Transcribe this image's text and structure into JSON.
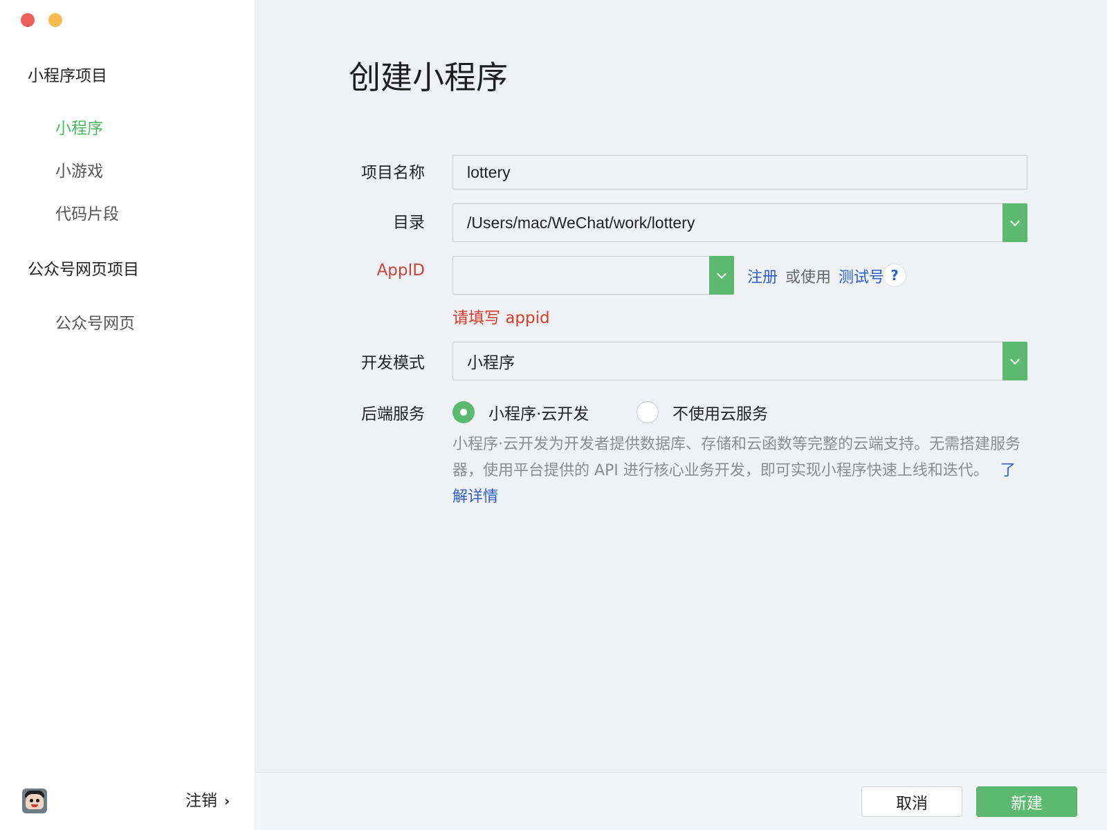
{
  "window": {
    "traffic_lights": [
      "close",
      "minimize"
    ]
  },
  "sidebar": {
    "group_mini": "小程序项目",
    "items_mini": [
      {
        "label": "小程序",
        "active": true
      },
      {
        "label": "小游戏",
        "active": false
      },
      {
        "label": "代码片段",
        "active": false
      }
    ],
    "group_official": "公众号网页项目",
    "items_official": [
      {
        "label": "公众号网页",
        "active": false
      }
    ],
    "logout_label": "注销",
    "avatar_icon": "user-avatar"
  },
  "main": {
    "title": "创建小程序",
    "project_name": {
      "label": "项目名称",
      "value": "lottery"
    },
    "directory": {
      "label": "目录",
      "value": "/Users/mac/WeChat/work/lottery"
    },
    "appid": {
      "label": "AppID",
      "value": "",
      "register_link": "注册",
      "or_use": "或使用",
      "test_link": "测试号",
      "help": "?",
      "error_prefix": "请填写",
      "error_word": "appid"
    },
    "dev_mode": {
      "label": "开发模式",
      "value": "小程序"
    },
    "backend": {
      "label": "后端服务",
      "options": [
        {
          "label": "小程序·云开发",
          "checked": true
        },
        {
          "label": "不使用云服务",
          "checked": false
        }
      ],
      "description": "小程序·云开发为开发者提供数据库、存储和云函数等完整的云端支持。无需搭建服务器，使用平台提供的 API 进行核心业务开发，即可实现小程序快速上线和迭代。",
      "learn_more": "了解详情"
    }
  },
  "footer": {
    "cancel_label": "取消",
    "create_label": "新建"
  },
  "colors": {
    "accent_green": "#5bba6f",
    "active_nav_green": "#4cb865",
    "link_blue": "#2e5fc8",
    "error_red": "#d63d2c",
    "panel_bg": "#eff1f4"
  }
}
